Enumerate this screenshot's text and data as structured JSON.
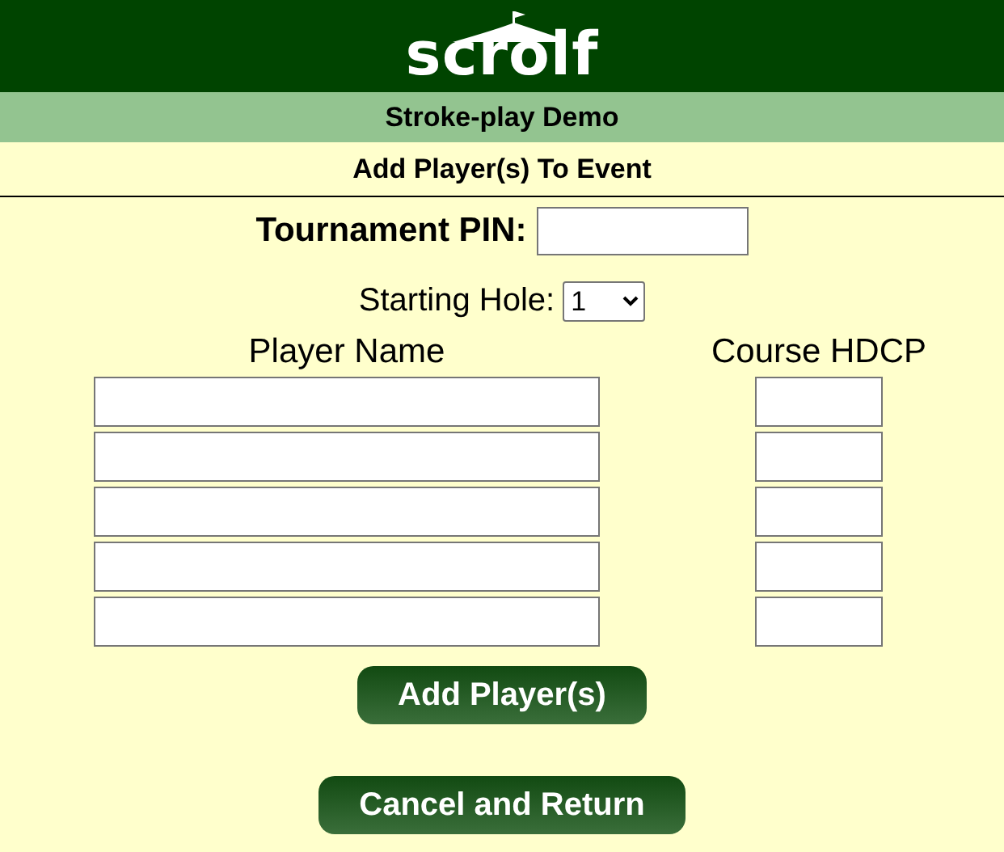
{
  "logo": "scrolf",
  "event_name": "Stroke-play Demo",
  "page_title": "Add Player(s) To Event",
  "pin": {
    "label": "Tournament PIN:"
  },
  "starting_hole": {
    "label": "Starting Hole:",
    "value": "1"
  },
  "columns": [
    "Player Name",
    "Course HDCP"
  ],
  "player_rows": [
    {
      "kind": "entry"
    },
    {
      "kind": "entry"
    },
    {
      "kind": "entry"
    },
    {
      "kind": "entry"
    },
    {
      "kind": "entry"
    }
  ],
  "buttons": [
    "Add Player(s)",
    "Cancel and Return"
  ]
}
